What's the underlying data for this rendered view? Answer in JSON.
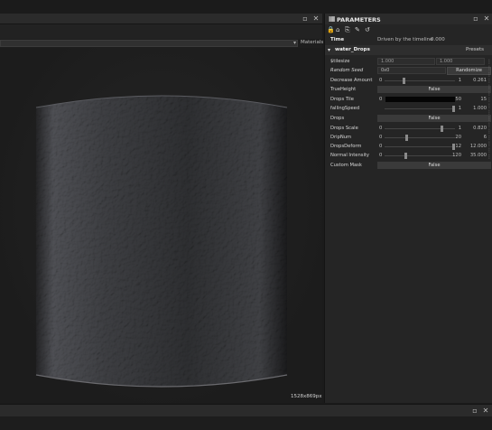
{
  "viewport": {
    "materials_label": "Materials",
    "resolution_label": "1528x869px",
    "restore_icon": "▫",
    "close_icon": "✕",
    "dropdown_arrow": "▾"
  },
  "parameters": {
    "title": "PARAMETERS",
    "title_icon": "▦",
    "toolbar_icons": [
      "🔒",
      "⌂",
      "⎘",
      "✎",
      "↺"
    ],
    "time_label": "Time",
    "time_driven": "Driven by the timeline",
    "time_value": "0.000",
    "section_name": "water_Drops",
    "section_arrow": "▾",
    "presets_label": "Presets",
    "rows": {
      "tilesize": {
        "label": "$tilesize",
        "x": "1.000",
        "y": "1.000"
      },
      "random_seed": {
        "label": "Random Seed",
        "value": "0x0",
        "button": "Randomize"
      },
      "decrease_amount": {
        "label": "Decrease Amount",
        "min": "0",
        "max": "1",
        "value": "0.261",
        "fraction": 0.261
      },
      "true_height": {
        "label": "TrueHeight",
        "value": "False"
      },
      "drops_tile": {
        "label": "Drops Tile",
        "min": "0",
        "max": "50",
        "value": "15",
        "fraction": 0.3
      },
      "falling_speed": {
        "label": "fallingSpeed",
        "max": "1",
        "value": "1.000",
        "fraction": 1.0
      },
      "drops": {
        "label": "Drops",
        "value": "False"
      },
      "drops_scale": {
        "label": "Drops Scale",
        "min": "0",
        "max": "1",
        "value": "0.820",
        "fraction": 0.82
      },
      "drip_num": {
        "label": "DripNum",
        "min": "0",
        "max": "20",
        "value": "6",
        "fraction": 0.3
      },
      "drops_deform": {
        "label": "DropsDeform",
        "min": "0",
        "max": "12",
        "value": "12.000",
        "fraction": 1.0
      },
      "normal_intensity": {
        "label": "Normal Intensity",
        "min": "0",
        "max": "120",
        "value": "35.000",
        "fraction": 0.29
      },
      "custom_mask": {
        "label": "Custom Mask",
        "value": "False"
      }
    }
  }
}
